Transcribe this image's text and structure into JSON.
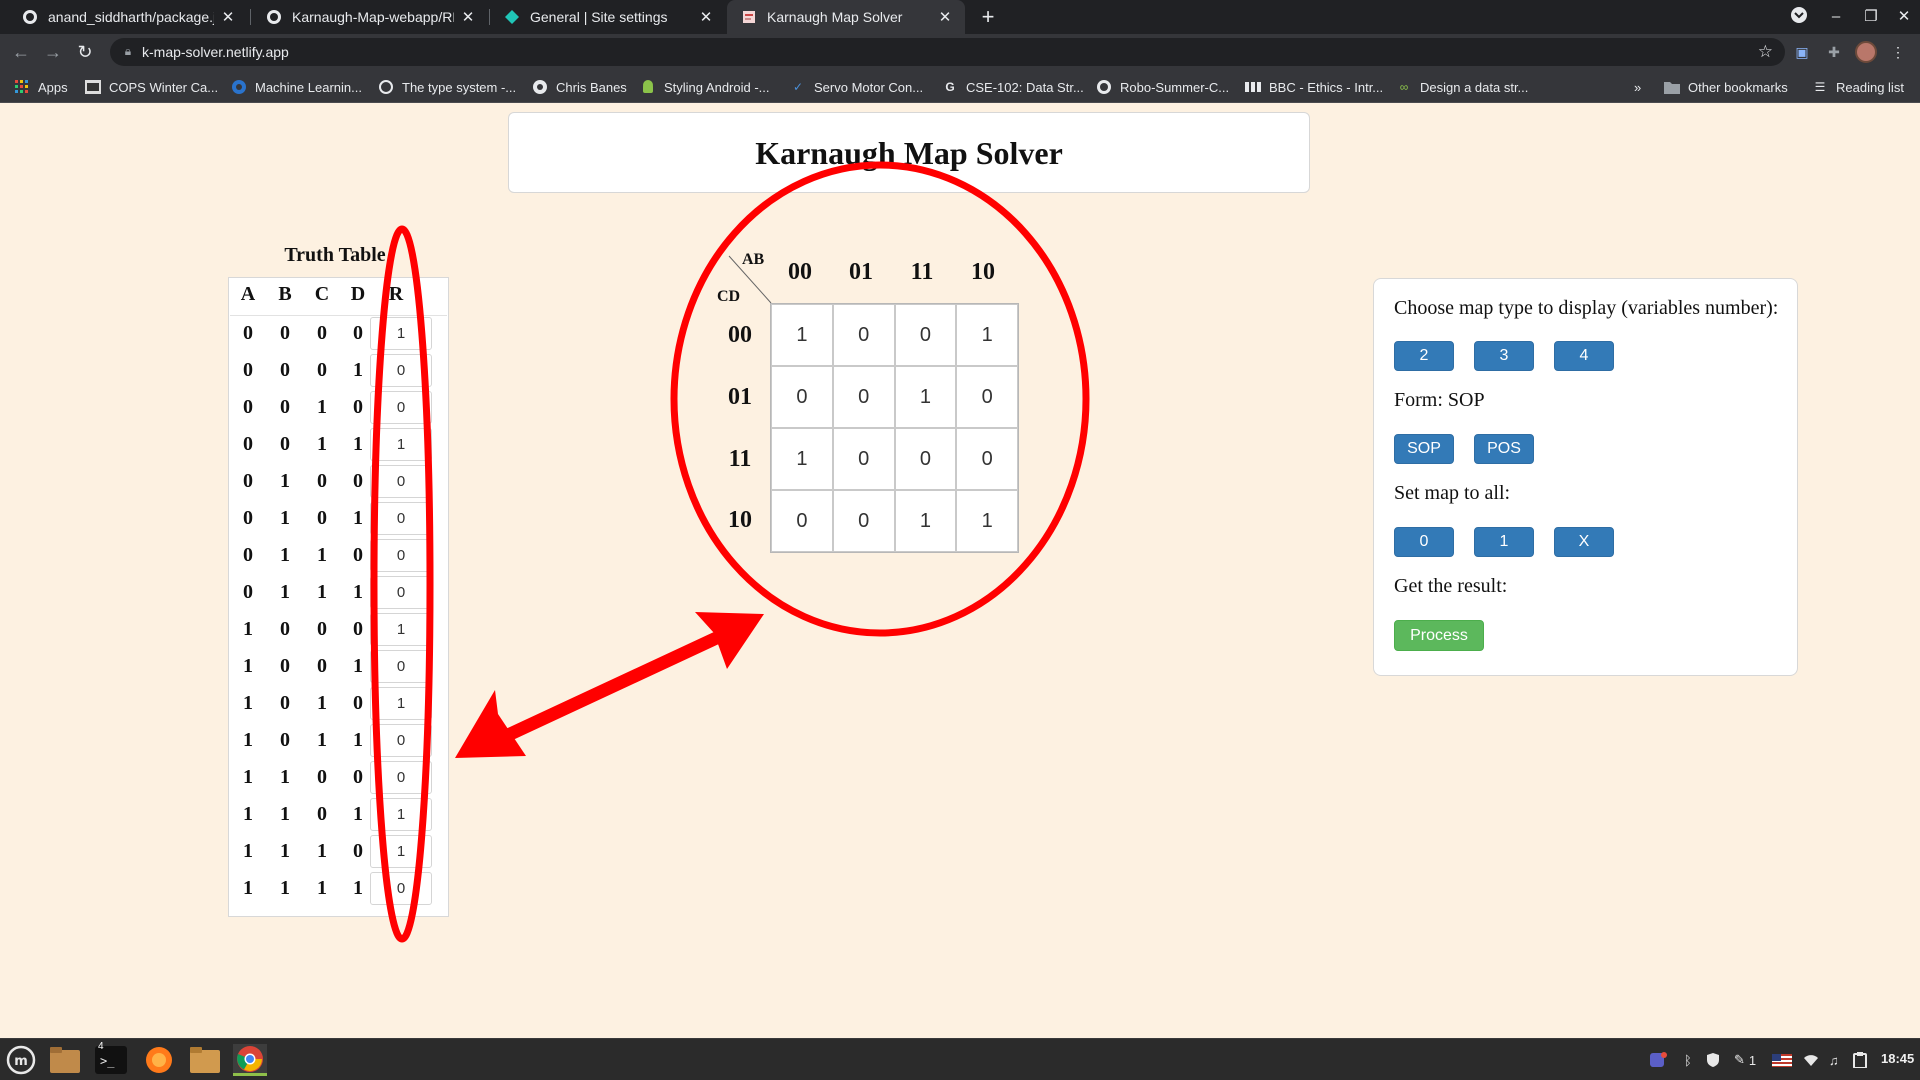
{
  "browser": {
    "tabs": [
      {
        "title": "anand_siddharth/package.jso",
        "icon": "github-icon"
      },
      {
        "title": "Karnaugh-Map-webapp/REAL",
        "icon": "github-icon"
      },
      {
        "title": "General | Site settings",
        "icon": "netlify-icon"
      },
      {
        "title": "Karnaugh Map Solver",
        "icon": "page-icon",
        "active": true
      }
    ],
    "url": "k-map-solver.netlify.app",
    "bookmarks": [
      {
        "label": "Apps",
        "icon": "apps-grid-icon"
      },
      {
        "label": "COPS Winter Ca...",
        "icon": "cops-icon"
      },
      {
        "label": "Machine Learnin...",
        "icon": "coursera-icon"
      },
      {
        "label": "The type system -...",
        "icon": "circle-icon"
      },
      {
        "label": "Chris Banes",
        "icon": "medium-icon"
      },
      {
        "label": "Styling Android -...",
        "icon": "android-icon"
      },
      {
        "label": "Servo Motor Con...",
        "icon": "check-icon"
      },
      {
        "label": "CSE-102: Data Str...",
        "icon": "google-icon"
      },
      {
        "label": "Robo-Summer-C...",
        "icon": "github-icon"
      },
      {
        "label": "BBC - Ethics - Intr...",
        "icon": "bbc-icon"
      },
      {
        "label": "Design a data str...",
        "icon": "link-icon"
      }
    ],
    "bookmarks_overflow": "»",
    "other_bookmarks": "Other bookmarks",
    "reading_list": "Reading list"
  },
  "page": {
    "title": "Karnaugh Map Solver",
    "truth_table": {
      "title": "Truth Table",
      "headers": [
        "A",
        "B",
        "C",
        "D",
        "R"
      ],
      "rows": [
        [
          "0",
          "0",
          "0",
          "0",
          "1"
        ],
        [
          "0",
          "0",
          "0",
          "1",
          "0"
        ],
        [
          "0",
          "0",
          "1",
          "0",
          "0"
        ],
        [
          "0",
          "0",
          "1",
          "1",
          "1"
        ],
        [
          "0",
          "1",
          "0",
          "0",
          "0"
        ],
        [
          "0",
          "1",
          "0",
          "1",
          "0"
        ],
        [
          "0",
          "1",
          "1",
          "0",
          "0"
        ],
        [
          "0",
          "1",
          "1",
          "1",
          "0"
        ],
        [
          "1",
          "0",
          "0",
          "0",
          "1"
        ],
        [
          "1",
          "0",
          "0",
          "1",
          "0"
        ],
        [
          "1",
          "0",
          "1",
          "0",
          "1"
        ],
        [
          "1",
          "0",
          "1",
          "1",
          "0"
        ],
        [
          "1",
          "1",
          "0",
          "0",
          "0"
        ],
        [
          "1",
          "1",
          "0",
          "1",
          "1"
        ],
        [
          "1",
          "1",
          "1",
          "0",
          "1"
        ],
        [
          "1",
          "1",
          "1",
          "1",
          "0"
        ]
      ]
    },
    "kmap": {
      "row_var": "AB",
      "col_var": "CD",
      "col_headers": [
        "00",
        "01",
        "11",
        "10"
      ],
      "row_headers": [
        "00",
        "01",
        "11",
        "10"
      ],
      "cells": [
        [
          "1",
          "0",
          "0",
          "1"
        ],
        [
          "0",
          "0",
          "1",
          "0"
        ],
        [
          "1",
          "0",
          "0",
          "0"
        ],
        [
          "0",
          "0",
          "1",
          "1"
        ]
      ]
    },
    "controls": {
      "map_type_label": "Choose map type to display (variables number):",
      "map_types": [
        "2",
        "3",
        "4"
      ],
      "form_label": "Form: SOP",
      "forms": [
        "SOP",
        "POS"
      ],
      "set_all_label": "Set map to all:",
      "set_all": [
        "0",
        "1",
        "X"
      ],
      "result_label": "Get the result:",
      "process": "Process"
    },
    "annotation_color": "#ff0000"
  },
  "taskbar": {
    "apps": [
      "mint-menu-icon",
      "files-icon",
      "terminal-icon",
      "firefox-icon",
      "folder-icon",
      "chrome-icon"
    ],
    "terminal_badge": "4",
    "tray_count": "1",
    "clock": "18:45"
  }
}
